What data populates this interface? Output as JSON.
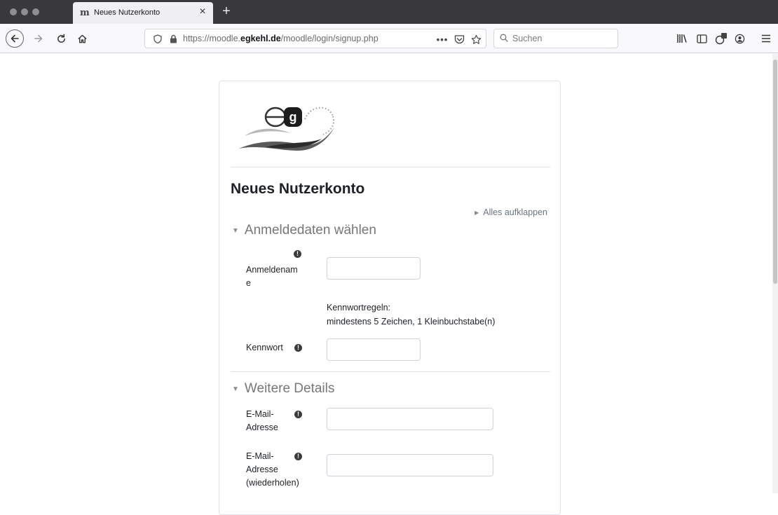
{
  "browser": {
    "tab_title": "Neues Nutzerkonto",
    "tab_favicon": "moodle-icon",
    "url_prefix": "https://moodle.",
    "url_domain": "egkehl.de",
    "url_path": "/moodle/login/signup.php",
    "search_placeholder": "Suchen"
  },
  "page": {
    "title": "Neues Nutzerkonto",
    "expand_all": "Alles aufklappen",
    "logo_alt": "eg"
  },
  "sections": {
    "login": {
      "heading": "Anmeldedaten wählen",
      "username_label_line1": "Anmeldenam",
      "username_label_line2": "e",
      "password_rules_title": "Kennwortregeln:",
      "password_rules_text": "mindestens 5 Zeichen, 1 Kleinbuchstabe(n)",
      "password_label": "Kennwort"
    },
    "details": {
      "heading": "Weitere Details",
      "email_label_line1": "E-Mail-",
      "email_label_line2": "Adresse",
      "email2_label_line1": "E-Mail-",
      "email2_label_line2": "Adresse",
      "email2_label_line3": "(wiederholen)"
    }
  },
  "colors": {
    "chrome_dark": "#38383d",
    "required_icon": "#3b3b3b",
    "section_heading": "#777777"
  }
}
